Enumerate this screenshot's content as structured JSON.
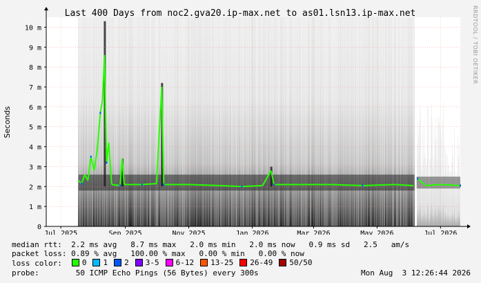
{
  "watermark": "RRDTOOL / TOBI OETIKER",
  "chart_data": {
    "type": "line",
    "title": "Last 400 Days from noc2.gva20.ip-max.net to as01.lsn13.ip-max.net",
    "ylabel": "Seconds",
    "xlabel": "",
    "ylim": [
      0,
      0.0105
    ],
    "y_ticks": [
      {
        "value": 0,
        "label": "0"
      },
      {
        "value": 0.001,
        "label": "1 m"
      },
      {
        "value": 0.002,
        "label": "2 m"
      },
      {
        "value": 0.003,
        "label": "3 m"
      },
      {
        "value": 0.004,
        "label": "4 m"
      },
      {
        "value": 0.005,
        "label": "5 m"
      },
      {
        "value": 0.006,
        "label": "6 m"
      },
      {
        "value": 0.007,
        "label": "7 m"
      },
      {
        "value": 0.008,
        "label": "8 m"
      },
      {
        "value": 0.009,
        "label": "9 m"
      },
      {
        "value": 0.01,
        "label": "10 m"
      }
    ],
    "xlim": [
      "2025-07-01",
      "2026-08-03"
    ],
    "x_ticks": [
      {
        "value": "2025-07-15",
        "label": "Jul 2025"
      },
      {
        "value": "2025-09-15",
        "label": "Sep 2025"
      },
      {
        "value": "2025-11-15",
        "label": "Nov 2025"
      },
      {
        "value": "2026-01-15",
        "label": "Jan 2026"
      },
      {
        "value": "2026-03-15",
        "label": "Mar 2026"
      },
      {
        "value": "2026-05-15",
        "label": "May 2026"
      },
      {
        "value": "2026-07-15",
        "label": "Jul 2026"
      }
    ],
    "data_start": "2025-08-01",
    "data_gap": [
      "2026-06-20",
      "2026-06-22"
    ],
    "grid": true,
    "median_series": [
      {
        "x": "2025-08-01",
        "y": 0.0023
      },
      {
        "x": "2025-08-04",
        "y": 0.00215
      },
      {
        "x": "2025-08-07",
        "y": 0.0026
      },
      {
        "x": "2025-08-10",
        "y": 0.0023
      },
      {
        "x": "2025-08-13",
        "y": 0.0035
      },
      {
        "x": "2025-08-16",
        "y": 0.0028
      },
      {
        "x": "2025-08-19",
        "y": 0.0038
      },
      {
        "x": "2025-08-22",
        "y": 0.0057
      },
      {
        "x": "2025-08-24",
        "y": 0.0063
      },
      {
        "x": "2025-08-26",
        "y": 0.0086
      },
      {
        "x": "2025-08-28",
        "y": 0.0032
      },
      {
        "x": "2025-08-30",
        "y": 0.0042
      },
      {
        "x": "2025-09-02",
        "y": 0.0021
      },
      {
        "x": "2025-09-10",
        "y": 0.00205
      },
      {
        "x": "2025-09-12",
        "y": 0.0034
      },
      {
        "x": "2025-09-14",
        "y": 0.0021
      },
      {
        "x": "2025-10-01",
        "y": 0.0021
      },
      {
        "x": "2025-10-15",
        "y": 0.00215
      },
      {
        "x": "2025-10-20",
        "y": 0.007
      },
      {
        "x": "2025-10-22",
        "y": 0.0021
      },
      {
        "x": "2025-11-15",
        "y": 0.0021
      },
      {
        "x": "2025-12-15",
        "y": 0.00205
      },
      {
        "x": "2026-01-05",
        "y": 0.002
      },
      {
        "x": "2026-01-25",
        "y": 0.00205
      },
      {
        "x": "2026-02-02",
        "y": 0.0028
      },
      {
        "x": "2026-02-05",
        "y": 0.0021
      },
      {
        "x": "2026-03-01",
        "y": 0.0021
      },
      {
        "x": "2026-04-01",
        "y": 0.0021
      },
      {
        "x": "2026-05-01",
        "y": 0.00205
      },
      {
        "x": "2026-06-01",
        "y": 0.0021
      },
      {
        "x": "2026-06-19",
        "y": 0.00205
      },
      {
        "x": "2026-06-23",
        "y": 0.0024
      },
      {
        "x": "2026-07-01",
        "y": 0.00205
      },
      {
        "x": "2026-07-15",
        "y": 0.0021
      },
      {
        "x": "2026-08-03",
        "y": 0.00205
      }
    ],
    "spikes": [
      {
        "x": "2025-08-26",
        "y": 0.0103
      },
      {
        "x": "2025-09-12",
        "y": 0.0034
      },
      {
        "x": "2025-10-20",
        "y": 0.0072
      },
      {
        "x": "2026-02-02",
        "y": 0.003
      }
    ]
  },
  "stats": {
    "median_rtt_label": "median rtt:",
    "median_rtt_values": "2.2 ms avg   8.7 ms max   2.0 ms min   2.0 ms now   0.9 ms sd   2.5   am/s",
    "packet_loss_label": "packet loss:",
    "packet_loss_values": "0.89 % avg   100.00 % max   0.00 % min   0.00 % now",
    "loss_color_label": "loss color:",
    "loss_colors": [
      {
        "label": "0",
        "color": "#26ff00"
      },
      {
        "label": "1",
        "color": "#00b8ff"
      },
      {
        "label": "2",
        "color": "#0059ff"
      },
      {
        "label": "3-5",
        "color": "#7e00ff"
      },
      {
        "label": "6-12",
        "color": "#ff00ff"
      },
      {
        "label": "13-25",
        "color": "#ff5500"
      },
      {
        "label": "26-49",
        "color": "#ff0000"
      },
      {
        "label": "50/50",
        "color": "#a10000"
      }
    ],
    "probe_label": "probe:",
    "probe_value": "50 ICMP Echo Pings (56 Bytes) every 300s",
    "timestamp": "Mon Aug  3 12:26:44 2026"
  }
}
